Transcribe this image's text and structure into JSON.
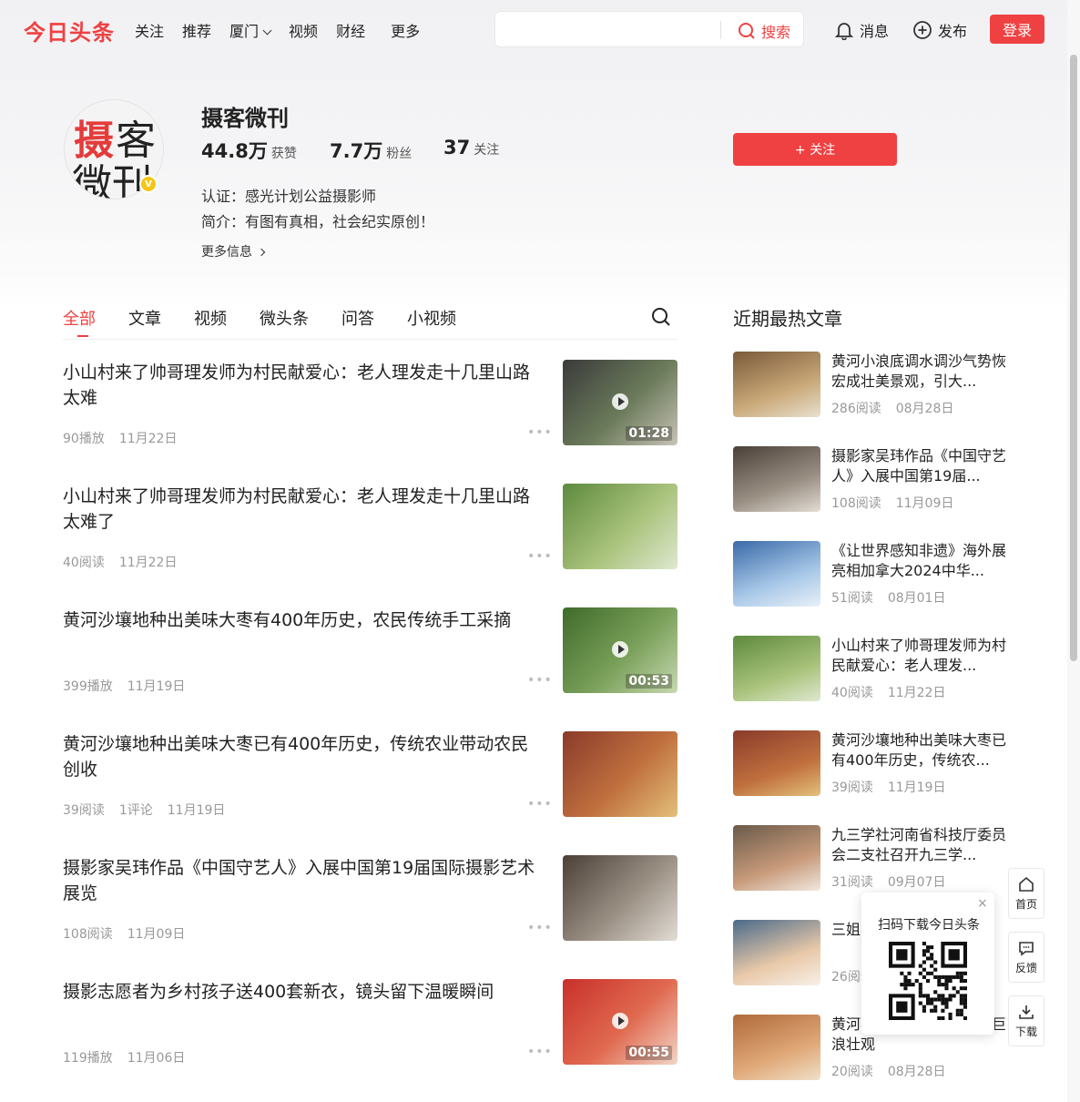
{
  "header": {
    "logo": "今日头条",
    "nav": [
      "关注",
      "推荐",
      "厦门",
      "视频",
      "财经",
      "更多"
    ],
    "search_placeholder": "",
    "search_button": "搜索",
    "messages": "消息",
    "publish": "发布",
    "login": "登录"
  },
  "profile": {
    "name": "摄客微刊",
    "avatar_chars": [
      "摄",
      "客",
      "微刊"
    ],
    "likes": "44.8万",
    "likes_label": "获赞",
    "fans": "7.7万",
    "fans_label": "粉丝",
    "following": "37",
    "following_label": "关注",
    "verification": "认证：感光计划公益摄影师",
    "intro": "简介：有图有真相，社会纪实原创！",
    "more_info": "更多信息",
    "follow_button": "+ 关注",
    "verified_badge": "V"
  },
  "tabs": [
    "全部",
    "文章",
    "视频",
    "微头条",
    "问答",
    "小视频"
  ],
  "feed": [
    {
      "title": "小山村来了帅哥理发师为村民献爱心：老人理发走十几里山路太难",
      "stats": [
        "90播放",
        "11月22日"
      ],
      "duration": "01:28",
      "video": true,
      "colors": [
        "#3a3a3a",
        "#6b7b5a",
        "#c9c3b8"
      ]
    },
    {
      "title": "小山村来了帅哥理发师为村民献爱心：老人理发走十几里山路太难了",
      "stats": [
        "40阅读",
        "11月22日"
      ],
      "duration": "",
      "video": false,
      "colors": [
        "#5d8a3e",
        "#a8c27a",
        "#dfe8d0"
      ]
    },
    {
      "title": "黄河沙壤地种出美味大枣有400年历史，农民传统手工采摘",
      "stats": [
        "399播放",
        "11月19日"
      ],
      "duration": "00:53",
      "video": true,
      "colors": [
        "#3f6b2a",
        "#7aa05a",
        "#c7d9b0"
      ]
    },
    {
      "title": "黄河沙壤地种出美味大枣已有400年历史，传统农业带动农民创收",
      "stats": [
        "39阅读",
        "1评论",
        "11月19日"
      ],
      "duration": "",
      "video": false,
      "colors": [
        "#8a3b2a",
        "#c0703e",
        "#e3c07a"
      ]
    },
    {
      "title": "摄影家吴玮作品《中国守艺人》入展中国第19届国际摄影艺术展览",
      "stats": [
        "108阅读",
        "11月09日"
      ],
      "duration": "",
      "video": false,
      "colors": [
        "#4a4038",
        "#9a8f83",
        "#e2ddd5"
      ]
    },
    {
      "title": "摄影志愿者为乡村孩子送400套新衣，镜头留下温暖瞬间",
      "stats": [
        "119播放",
        "11月06日"
      ],
      "duration": "00:55",
      "video": true,
      "colors": [
        "#c8302a",
        "#e06a50",
        "#f3d6c8"
      ]
    }
  ],
  "hot_title": "近期最热文章",
  "hot": [
    {
      "title": "黄河小浪底调水调沙气势恢宏成壮美景观，引大...",
      "stats": [
        "286阅读",
        "08月28日"
      ],
      "colors": [
        "#7a5a3a",
        "#c9a878",
        "#e8e0d0"
      ]
    },
    {
      "title": "摄影家吴玮作品《中国守艺人》入展中国第19届...",
      "stats": [
        "108阅读",
        "11月09日"
      ],
      "colors": [
        "#4a4038",
        "#9a8f83",
        "#e2ddd5"
      ]
    },
    {
      "title": "《让世界感知非遗》海外展亮相加拿大2024中华...",
      "stats": [
        "51阅读",
        "08月01日"
      ],
      "colors": [
        "#3a6aa8",
        "#a8c8e8",
        "#e8f0f8"
      ]
    },
    {
      "title": "小山村来了帅哥理发师为村民献爱心：老人理发...",
      "stats": [
        "40阅读",
        "11月22日"
      ],
      "colors": [
        "#5d8a3e",
        "#a8c27a",
        "#dfe8d0"
      ]
    },
    {
      "title": "黄河沙壤地种出美味大枣已有400年历史，传统农...",
      "stats": [
        "39阅读",
        "11月19日"
      ],
      "colors": [
        "#8a3b2a",
        "#c0703e",
        "#e3c07a"
      ]
    },
    {
      "title": "九三学社河南省科技厅委员会二支社召开九三学...",
      "stats": [
        "31阅读",
        "09月07日"
      ],
      "colors": [
        "#6a5a4a",
        "#c89a7a",
        "#f0e8e0"
      ]
    },
    {
      "title": "三姐小花",
      "stats": [
        "26阅读",
        ""
      ],
      "colors": [
        "#4a6a8a",
        "#e8c8a8",
        "#f8f0e8"
      ]
    },
    {
      "title": "黄河小浪底恢宏，数十米巨浪壮观",
      "stats": [
        "20阅读",
        "08月28日"
      ],
      "colors": [
        "#b06a3a",
        "#e0a878",
        "#f0e0c8"
      ]
    }
  ],
  "qr_popup": {
    "text": "扫码下载今日头条",
    "close": "×"
  },
  "side": {
    "home": "首页",
    "feedback": "反馈",
    "download": "下载"
  },
  "accent": "#f04142"
}
